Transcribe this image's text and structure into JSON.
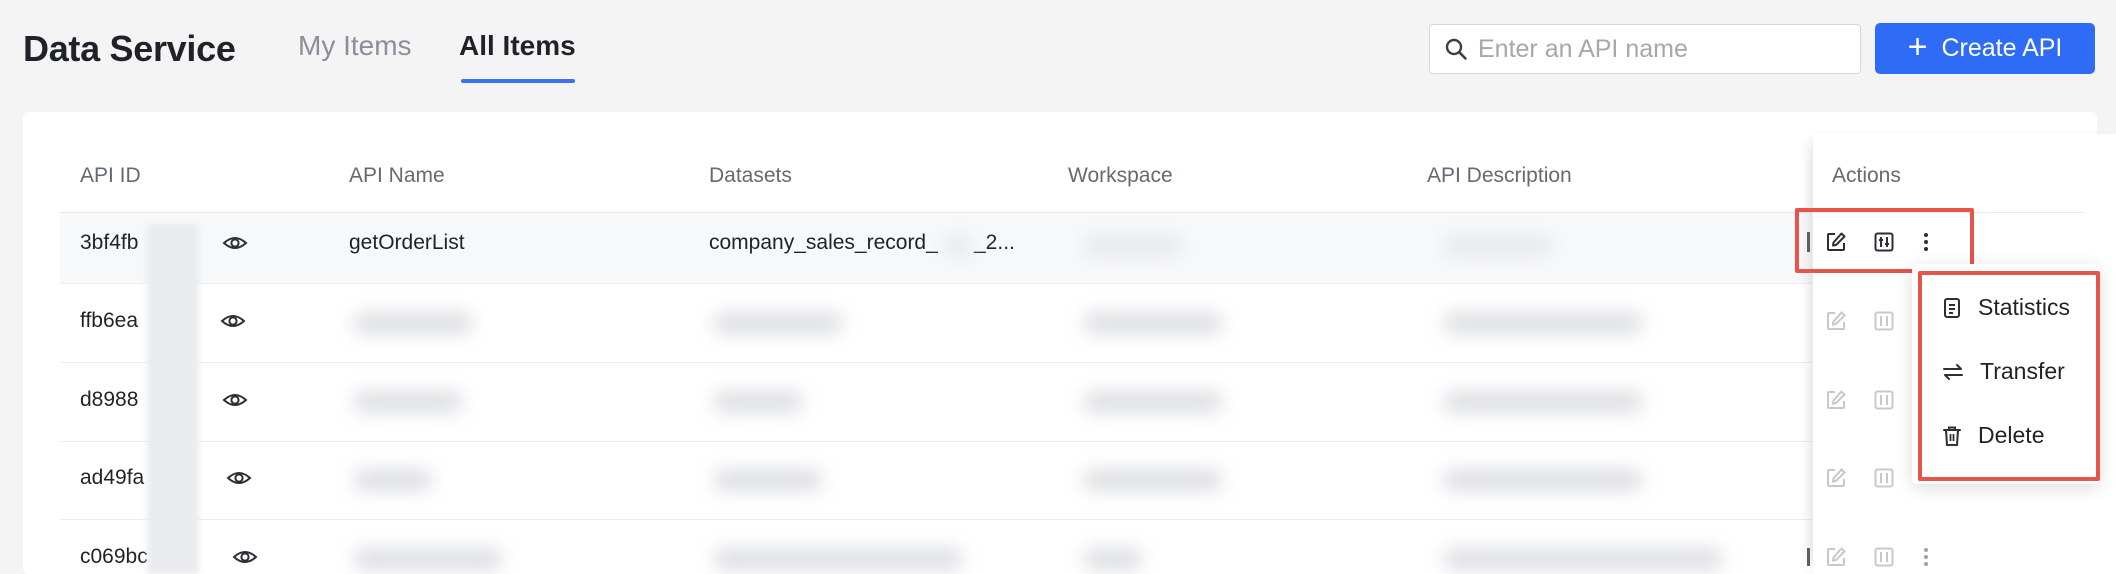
{
  "header": {
    "title": "Data Service",
    "tabs": [
      {
        "label": "My Items",
        "active": false
      },
      {
        "label": "All Items",
        "active": true
      }
    ],
    "search": {
      "placeholder": "Enter an API name",
      "value": ""
    },
    "create_button": "Create API"
  },
  "table": {
    "columns": [
      "API ID",
      "API Name",
      "Datasets",
      "Workspace",
      "API Description",
      "Actions"
    ],
    "rows": [
      {
        "api_id": "3bf4fb",
        "api_name": "getOrderList",
        "dataset_prefix": "company_sales_record_",
        "dataset_suffix": "_2..."
      },
      {
        "api_id": "ffb6ea",
        "api_name": "",
        "dataset_prefix": "",
        "dataset_suffix": ""
      },
      {
        "api_id": "d8988",
        "api_name": "",
        "dataset_prefix": "",
        "dataset_suffix": ""
      },
      {
        "api_id": "ad49fa",
        "api_name": "",
        "dataset_prefix": "",
        "dataset_suffix": ""
      },
      {
        "api_id": "c069bc",
        "api_name": "",
        "dataset_prefix": "",
        "dataset_suffix": ""
      }
    ]
  },
  "more_menu": {
    "items": [
      {
        "label": "Statistics",
        "icon": "list-icon"
      },
      {
        "label": "Transfer",
        "icon": "swap-arrows-icon"
      },
      {
        "label": "Delete",
        "icon": "trash-icon"
      }
    ]
  },
  "colors": {
    "accent": "#2f6cf6",
    "highlight_box": "#e8534a",
    "tab_underline": "#3b6ff5"
  }
}
